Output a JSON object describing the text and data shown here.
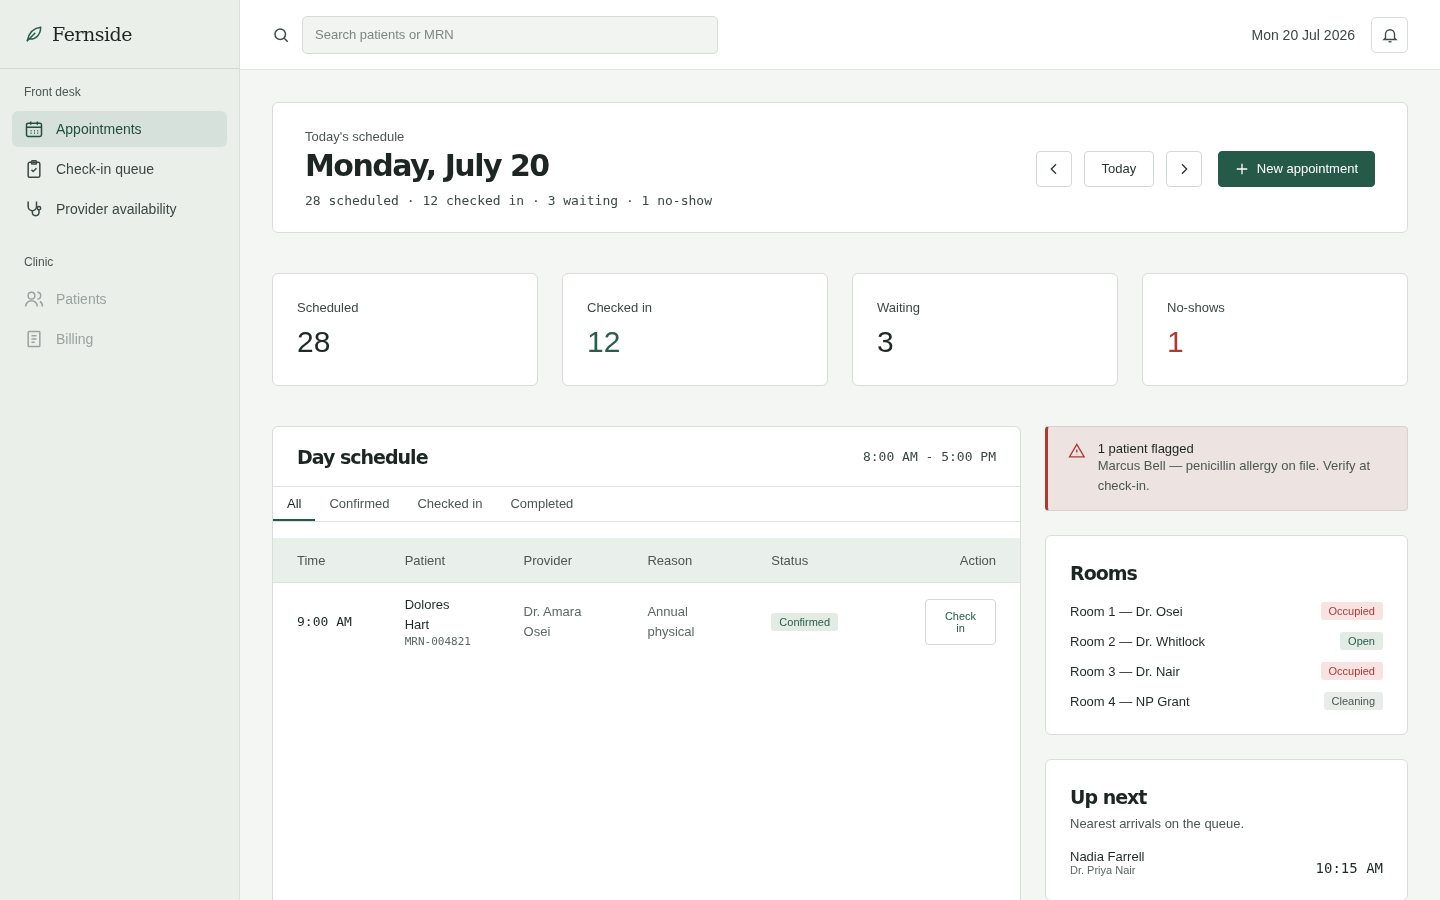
{
  "brand": {
    "name": "Fernside"
  },
  "sidebar": {
    "sections": [
      {
        "heading": "Front desk",
        "items": [
          {
            "label": "Appointments",
            "kind": "calendar",
            "selected": true,
            "disabled": false
          },
          {
            "label": "Check-in queue",
            "kind": "clipboard",
            "selected": false,
            "disabled": false
          },
          {
            "label": "Provider availability",
            "kind": "stethoscope",
            "selected": false,
            "disabled": false
          }
        ]
      },
      {
        "heading": "Clinic",
        "items": [
          {
            "label": "Patients",
            "kind": "people",
            "selected": false,
            "disabled": true
          },
          {
            "label": "Billing",
            "kind": "receipt",
            "selected": false,
            "disabled": true
          }
        ]
      }
    ]
  },
  "topbar": {
    "search": {
      "placeholder": "Search patients or MRN"
    },
    "date": "Mon 20 Jul 2026"
  },
  "header": {
    "eyebrow": "Today's schedule",
    "title": "Monday, July 20",
    "summary": "28 scheduled · 12 checked in · 3 waiting · 1 no-show",
    "today_button": "Today",
    "new_button": "New appointment"
  },
  "stats": [
    {
      "label": "Scheduled",
      "value": "28",
      "color": "#1f2a26"
    },
    {
      "label": "Checked in",
      "value": "12",
      "color": "#2a5e4c"
    },
    {
      "label": "Waiting",
      "value": "3",
      "color": "#1f2a26"
    },
    {
      "label": "No-shows",
      "value": "1",
      "color": "#b03a32"
    }
  ],
  "schedule": {
    "title": "Day schedule",
    "hours": "8:00 AM - 5:00 PM",
    "tabs": [
      {
        "label": "All",
        "selected": true
      },
      {
        "label": "Confirmed",
        "selected": false
      },
      {
        "label": "Checked in",
        "selected": false
      },
      {
        "label": "Completed",
        "selected": false
      }
    ],
    "columns": [
      "Time",
      "Patient",
      "Provider",
      "Reason",
      "Status",
      "Action"
    ],
    "rows": [
      {
        "time": "9:00 AM",
        "patient": "Dolores Hart",
        "mrn": "MRN-004821",
        "provider": "Dr. Amara Osei",
        "reason": "Annual physical",
        "status": {
          "label": "Confirmed",
          "kind": "confirmed"
        },
        "action": "Check in"
      }
    ]
  },
  "alert": {
    "title": "1 patient flagged",
    "message": "Marcus Bell — penicillin allergy on file. Verify at check-in."
  },
  "rooms": {
    "title": "Rooms",
    "items": [
      {
        "name": "Room 1 — Dr. Osei",
        "status": "Occupied",
        "kind": "occupied"
      },
      {
        "name": "Room 2 — Dr. Whitlock",
        "status": "Open",
        "kind": "open"
      },
      {
        "name": "Room 3 — Dr. Nair",
        "status": "Occupied",
        "kind": "occupied"
      },
      {
        "name": "Room 4 — NP Grant",
        "status": "Cleaning",
        "kind": "cleaning"
      }
    ]
  },
  "up_next": {
    "title": "Up next",
    "subtitle": "Nearest arrivals on the queue.",
    "items": [
      {
        "name": "Nadia Farrell",
        "provider": "Dr. Priya Nair",
        "time": "10:15 AM"
      }
    ]
  }
}
